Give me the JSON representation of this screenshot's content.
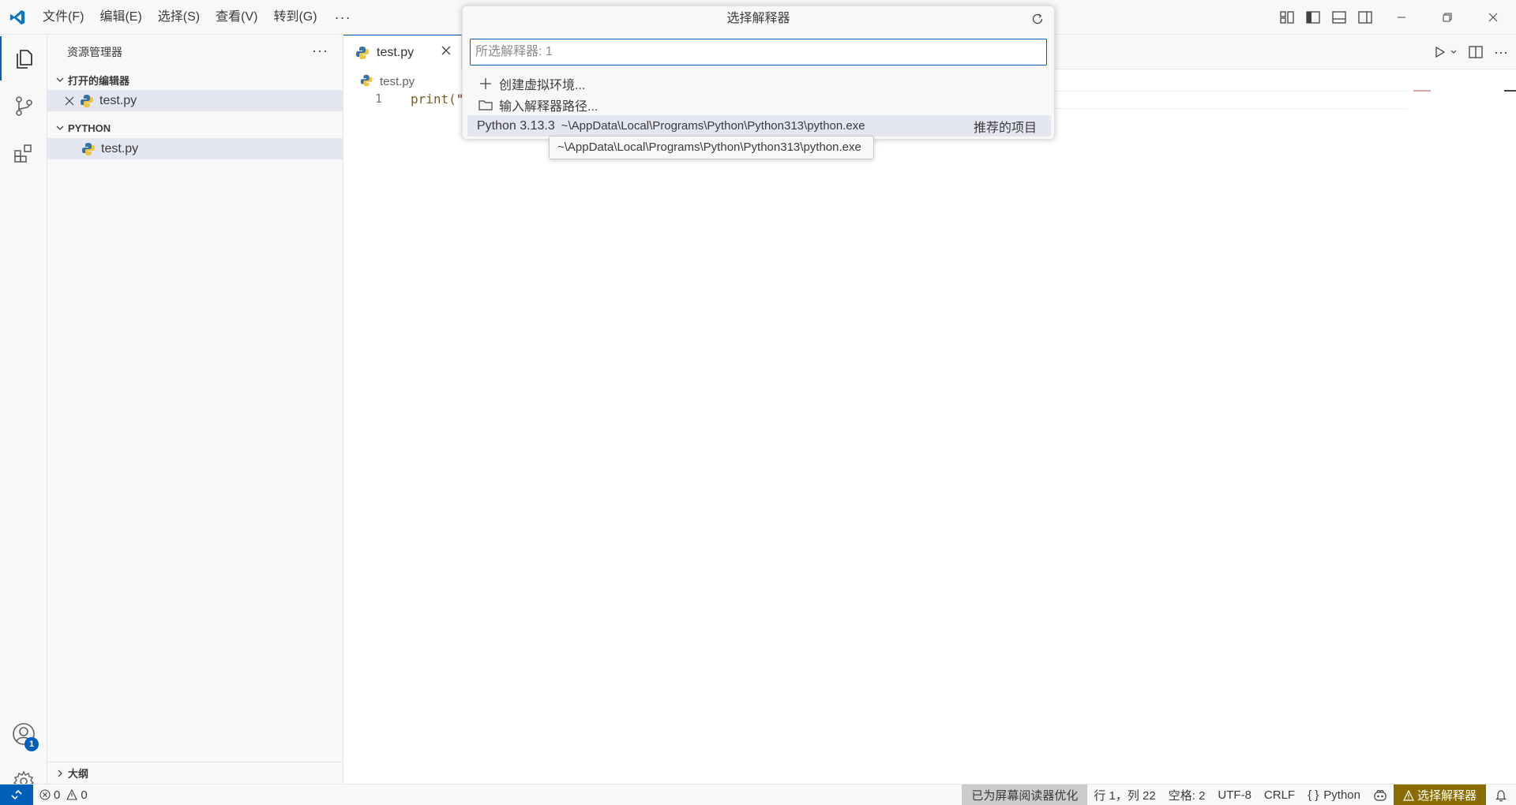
{
  "titlebar": {
    "menus": [
      "文件(F)",
      "编辑(E)",
      "选择(S)",
      "查看(V)",
      "转到(G)"
    ],
    "more": "···"
  },
  "sidebar": {
    "title": "资源管理器",
    "more": "···",
    "open_editors_label": "打开的编辑器",
    "open_editor_file": "test.py",
    "folder_label": "PYTHON",
    "folder_file": "test.py",
    "outline_label": "大纲"
  },
  "activity": {
    "accounts_badge": "1"
  },
  "editor": {
    "tab_label": "test.py",
    "breadcrumb_file": "test.py",
    "line_number": "1",
    "code_func": "print(",
    "code_str": "\""
  },
  "quickpick": {
    "title": "选择解释器",
    "placeholder": "所选解释器: 1",
    "items": [
      {
        "label": "创建虚拟环境...",
        "icon": "plus-icon"
      },
      {
        "label": "输入解释器路径...",
        "icon": "folder-icon"
      },
      {
        "label": "Python 3.13.3",
        "path": "~\\AppData\\Local\\Programs\\Python\\Python313\\python.exe",
        "tag": "推荐的项目"
      }
    ],
    "tooltip": "~\\AppData\\Local\\Programs\\Python\\Python313\\python.exe"
  },
  "statusbar": {
    "errors": "0",
    "warnings": "0",
    "a11y": "已为屏幕阅读器优化",
    "position": "行 1，列 22",
    "spaces": "空格: 2",
    "encoding": "UTF-8",
    "eol": "CRLF",
    "language_prefix": "{ }",
    "language": "Python",
    "interpreter_warning": "选择解释器"
  },
  "colors": {
    "accent": "#005fb8",
    "selection": "#e4e6f1",
    "warning_bg": "#8a6d00"
  }
}
